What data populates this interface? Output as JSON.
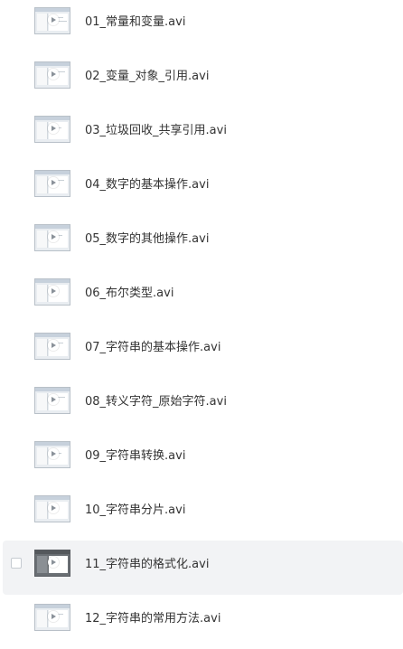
{
  "files": [
    {
      "name": "01_常量和变量.avi",
      "selected": false
    },
    {
      "name": "02_变量_对象_引用.avi",
      "selected": false
    },
    {
      "name": "03_垃圾回收_共享引用.avi",
      "selected": false
    },
    {
      "name": "04_数字的基本操作.avi",
      "selected": false
    },
    {
      "name": "05_数字的其他操作.avi",
      "selected": false
    },
    {
      "name": "06_布尔类型.avi",
      "selected": false
    },
    {
      "name": "07_字符串的基本操作.avi",
      "selected": false
    },
    {
      "name": "08_转义字符_原始字符.avi",
      "selected": false
    },
    {
      "name": "09_字符串转换.avi",
      "selected": false
    },
    {
      "name": "10_字符串分片.avi",
      "selected": false
    },
    {
      "name": "11_字符串的格式化.avi",
      "selected": true
    },
    {
      "name": "12_字符串的常用方法.avi",
      "selected": false
    }
  ],
  "icons": {
    "thumbnail": "video-thumbnail-icon",
    "play": "play-icon",
    "checkbox": "checkbox-unchecked-icon"
  },
  "colors": {
    "selected_row_bg": "#f2f3f5",
    "text": "#333333"
  }
}
